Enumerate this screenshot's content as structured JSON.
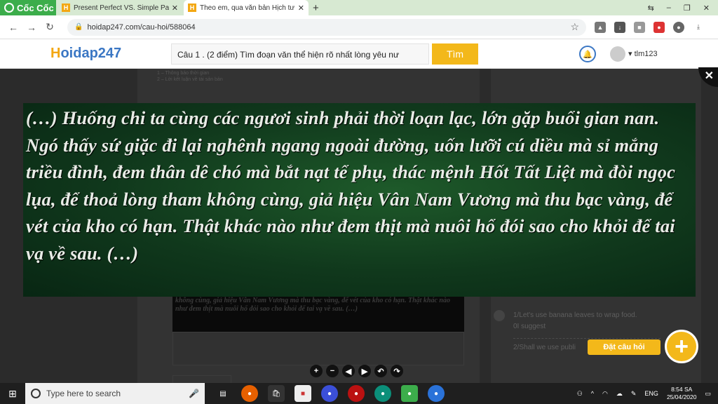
{
  "browser": {
    "brand": "Cốc Cốc",
    "tabs": [
      {
        "title": "Present Perfect VS. Simple Pa",
        "favicon": "H"
      },
      {
        "title": "Theo em, qua văn bản Hịch tư",
        "favicon": "H"
      }
    ],
    "url": "hoidap247.com/cau-hoi/588064"
  },
  "site": {
    "logo_first": "H",
    "logo_rest": "oidap247",
    "search_value": "Câu 1 . (2 điểm) Tìm đoạn văn thể hiện rõ nhất lòng yêu nư",
    "search_button": "Tìm",
    "username": "tlm123"
  },
  "lightbox": {
    "passage": "(…) Huống chi ta cùng các ngươi sinh phải thời loạn lạc, lớn gặp buổi gian nan. Ngó thấy sứ giặc đi lại nghênh ngang ngoài đường, uốn lưỡi cú diều mà sỉ mắng triều đình, đem thân dê chó mà bắt nạt tể phụ, thác mệnh Hốt Tất Liệt mà đòi ngọc lụa, để thoả lòng tham không cùng, giả hiệu Vân Nam Vương mà thu bạc vàng, để vét của kho có hạn. Thật khác nào như đem thịt mà nuôi hổ đói sao cho khỏi để tai vạ về sau. (…)"
  },
  "background": {
    "faded_lines": [
      "1 – Thông báo thời gian",
      "2 – Lời kết luận về tài sản bản"
    ],
    "image_fragment": "không cùng, giả hiệu Vân Nam Vương mà thu bạc vàng, để vét của kho có hạn. Thật khác nào như đem thịt mà nuôi hổ đói sao cho khỏi để tai vạ về sau. (…)",
    "answer1_line1": "1/Let's use banana leaves to wrap food.",
    "answer1_line2": "0I suggest",
    "answer2": "2/Shall we use publi"
  },
  "ask": {
    "label": "Đặt câu hỏi",
    "plus": "+"
  },
  "taskbar": {
    "search_placeholder": "Type here to search",
    "lang": "ENG",
    "time": "8:54 SA",
    "date": "25/04/2020"
  }
}
